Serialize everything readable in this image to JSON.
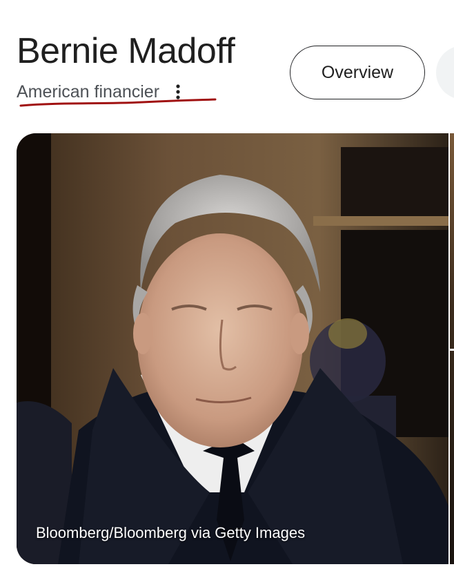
{
  "entity": {
    "title": "Bernie Madoff",
    "subtitle": "American financier"
  },
  "chips": {
    "overview_label": "Overview"
  },
  "icons": {
    "more": "more-vert-icon"
  },
  "image": {
    "caption": "Bloomberg/Bloomberg via Getty Images"
  },
  "colors": {
    "annotation_underline": "#a01010",
    "chip_border": "#202124",
    "subtitle": "#4d5156"
  }
}
